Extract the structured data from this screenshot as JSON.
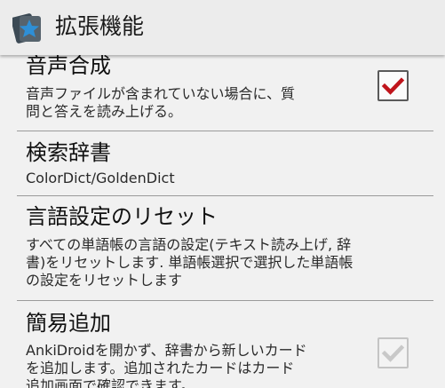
{
  "action_bar": {
    "title": "拡張機能",
    "app_icon": "anki-star-icon"
  },
  "preferences": [
    {
      "title": "音声合成",
      "summary": "音声ファイルが含まれていない場合に、質\n問と答えを読み上げる。",
      "checkbox": {
        "checked": true,
        "enabled": true
      }
    },
    {
      "title": "検索辞書",
      "summary": "ColorDict/GoldenDict"
    },
    {
      "title": "言語設定のリセット",
      "summary": "すべての単語帳の言語の設定(テキスト読み上げ, 辞\n書)をリセットします. 単語帳選択で選択した単語帳\nの設定をリセットします"
    },
    {
      "title": "簡易追加",
      "summary": "AnkiDroidを開かず、辞書から新しいカード\nを追加します。追加されたカードはカード\n追加画面で確認できます。",
      "checkbox": {
        "checked": true,
        "enabled": false
      }
    }
  ],
  "colors": {
    "check_active": "#c0141b",
    "check_disabled": "#c8c8c8",
    "icon_blue": "#2e8fd6",
    "icon_dark": "#3c4a55"
  }
}
